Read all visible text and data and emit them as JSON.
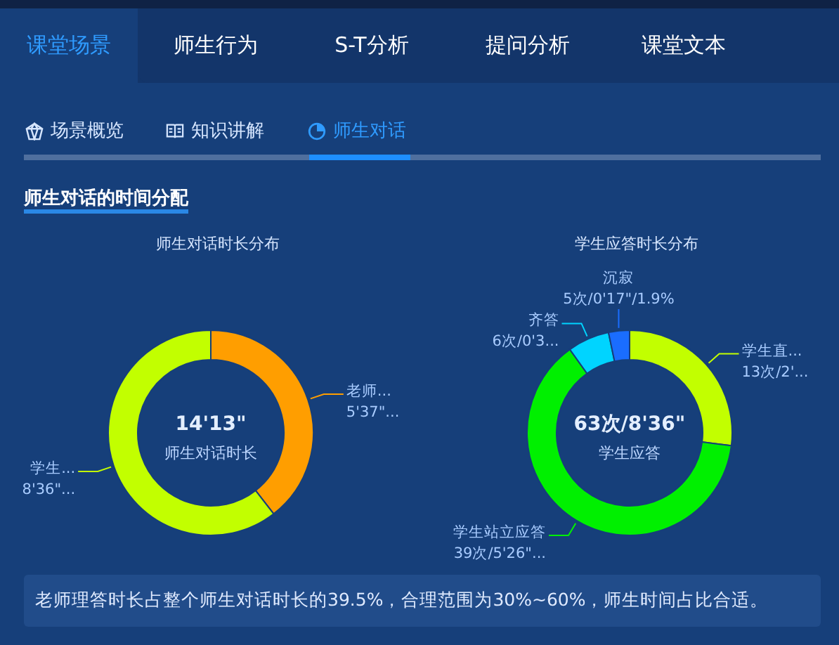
{
  "main_tabs": [
    {
      "label": "课堂场景",
      "selected": true
    },
    {
      "label": "师生行为",
      "selected": false
    },
    {
      "label": "S-T分析",
      "selected": false
    },
    {
      "label": "提问分析",
      "selected": false
    },
    {
      "label": "课堂文本",
      "selected": false
    }
  ],
  "sub_tabs": [
    {
      "label": "场景概览",
      "selected": false
    },
    {
      "label": "知识讲解",
      "selected": false
    },
    {
      "label": "师生对话",
      "selected": true
    }
  ],
  "section_title": "师生对话的时间分配",
  "charts": [
    {
      "center_value": "14'13\"",
      "center_label": "师生对话时长",
      "chart_data": {
        "type": "donut",
        "title": "师生对话时长分布",
        "categories": [
          "老师...",
          "学生..."
        ],
        "value_labels": [
          "5'37\"...",
          "8'36\"..."
        ],
        "series": [
          {
            "colors": [
              "#ff9e00",
              "#c2ff00"
            ],
            "values": [
              39.5,
              60.5
            ]
          }
        ]
      }
    },
    {
      "center_value": "63次/8'36\"",
      "center_label": "学生应答",
      "chart_data": {
        "type": "donut",
        "title": "学生应答时长分布",
        "categories": [
          "学生直...",
          "学生站立应答",
          "齐答",
          "沉寂"
        ],
        "value_labels": [
          "13次/2'...",
          "39次/5'26\"...",
          "6次/0'3...",
          "5次/0'17\"/1.9%"
        ],
        "series": [
          {
            "colors": [
              "#c2ff00",
              "#00f000",
              "#00d4ff",
              "#1a6dff"
            ],
            "values": [
              27,
              63.1,
              6.6,
              3.3
            ]
          }
        ]
      }
    }
  ],
  "summary": "老师理答时长占整个师生对话时长的39.5%，合理范围为30%~60%，师生时间占比合适。"
}
